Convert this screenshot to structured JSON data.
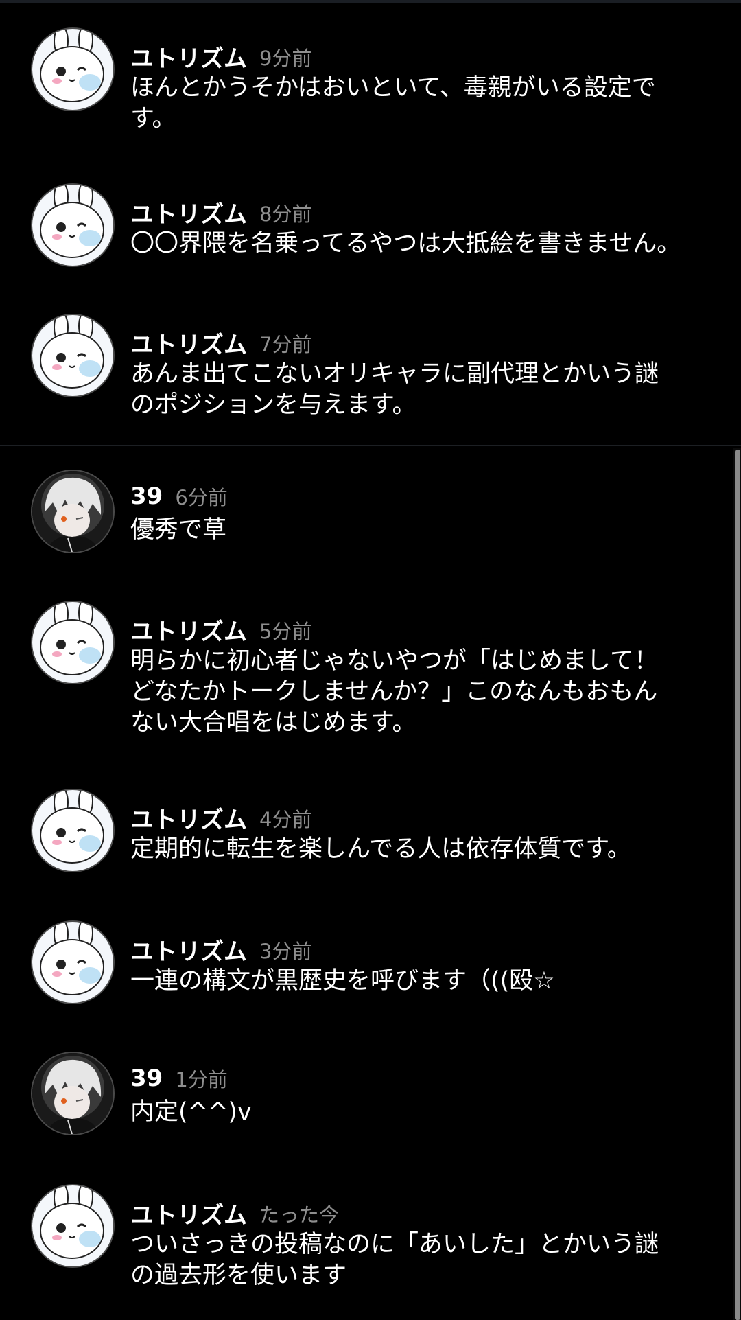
{
  "messages": [
    {
      "user": "ユトリズム",
      "avatar": "bunny-avatar-icon",
      "time": "9分前",
      "text": "ほんとかうそかはおいといて、毒親がいる設定で\nす。"
    },
    {
      "user": "ユトリズム",
      "avatar": "bunny-avatar-icon",
      "time": "8分前",
      "text": "〇〇界隈を名乗ってるやつは大抵絵を書きません。"
    },
    {
      "user": "ユトリズム",
      "avatar": "bunny-avatar-icon",
      "time": "7分前",
      "text": "あんま出てこないオリキャラに副代理とかいう謎\nのポジションを与えます。"
    },
    {
      "user": "39",
      "avatar": "white-hair-character-avatar-icon",
      "time": "6分前",
      "text": "優秀で草"
    },
    {
      "user": "ユトリズム",
      "avatar": "bunny-avatar-icon",
      "time": "5分前",
      "text": "明らかに初心者じゃないやつが「はじめまして！\nどなたかトークしませんか？」このなんもおもん\nない大合唱をはじめます。"
    },
    {
      "user": "ユトリズム",
      "avatar": "bunny-avatar-icon",
      "time": "4分前",
      "text": "定期的に転生を楽しんでる人は依存体質です。"
    },
    {
      "user": "ユトリズム",
      "avatar": "bunny-avatar-icon",
      "time": "3分前",
      "text": "一連の構文が黒歴史を呼びます（((殴☆"
    },
    {
      "user": "39",
      "avatar": "white-hair-character-avatar-icon",
      "time": "1分前",
      "text": "内定(^^)v"
    },
    {
      "user": "ユトリズム",
      "avatar": "bunny-avatar-icon",
      "time": "たった今",
      "text": "ついさっきの投稿なのに「あいした」とかいう謎\nの過去形を使います"
    }
  ],
  "colors": {
    "background": "#000000",
    "name": "#ffffff",
    "timestamp": "#8e8e8e",
    "text": "#ffffff"
  }
}
